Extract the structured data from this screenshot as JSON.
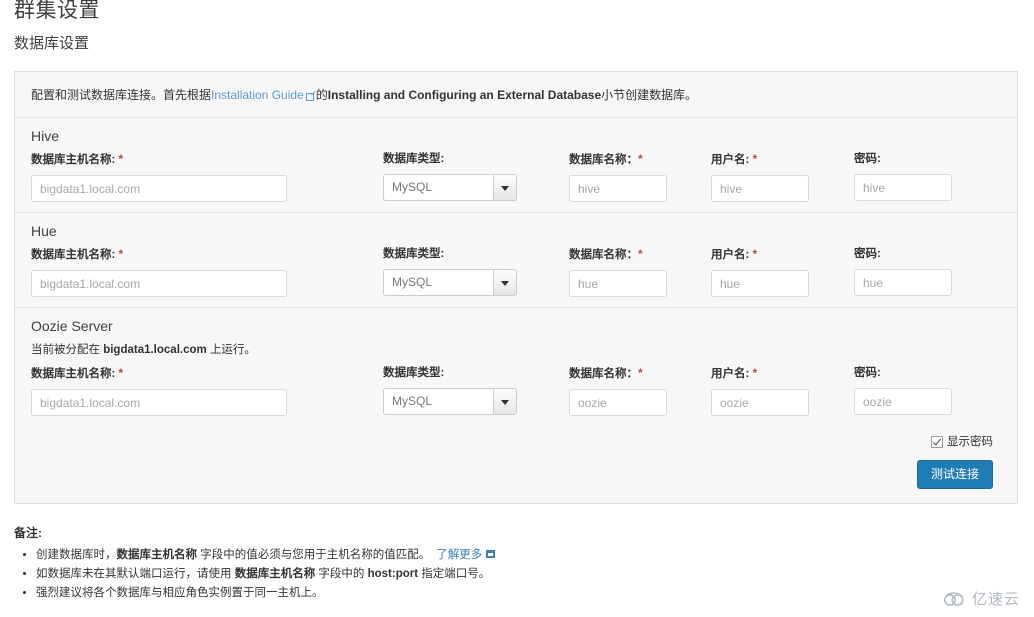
{
  "page": {
    "title": "群集设置",
    "subtitle": "数据库设置"
  },
  "panel": {
    "desc_before_link": "配置和测试数据库连接。首先根据",
    "desc_link": "Installation Guide",
    "desc_mid": "的",
    "desc_bold": "Installing and Configuring an External Database",
    "desc_after": "小节创建数据库。"
  },
  "labels": {
    "host": "数据库主机名称:",
    "type": "数据库类型:",
    "dbname": "数据库名称：",
    "username": "用户名:",
    "password": "密码:",
    "required_mark": "*"
  },
  "services": [
    {
      "name": "Hive",
      "note": "",
      "host_value": "bigdata1.local.com",
      "type_value": "MySQL",
      "db_value": "hive",
      "user_value": "hive",
      "pass_value": "hive"
    },
    {
      "name": "Hue",
      "note": "",
      "host_value": "bigdata1.local.com",
      "type_value": "MySQL",
      "db_value": "hue",
      "user_value": "hue",
      "pass_value": "hue"
    },
    {
      "name": "Oozie Server",
      "note_prefix": "当前被分配在 ",
      "note_bold": "bigdata1.local.com",
      "note_suffix": " 上运行。",
      "host_value": "bigdata1.local.com",
      "type_value": "MySQL",
      "db_value": "oozie",
      "user_value": "oozie",
      "pass_value": "oozie"
    }
  ],
  "footer": {
    "show_password_label": "显示密码",
    "show_password_checked": true,
    "test_button_label": "测试连接"
  },
  "notes": {
    "title": "备注:",
    "items": [
      {
        "pre": "创建数据库时，",
        "bold": "数据库主机名称",
        "post": " 字段中的值必须与您用于主机名称的值匹配。",
        "link": "了解更多"
      },
      {
        "pre": "如数据库未在其默认端口运行，请使用 ",
        "bold": "数据库主机名称",
        "post": " 字段中的 ",
        "bold2": "host:port",
        "post2": " 指定端口号。"
      },
      {
        "pre": "强烈建议将各个数据库与相应角色实例置于同一主机上。"
      }
    ]
  },
  "watermark": {
    "text": "亿速云"
  },
  "colors": {
    "accent": "#1f7cb4",
    "link": "#5b9bd5",
    "required": "#b94a48",
    "panel_bg": "#f7f7f7",
    "panel_border": "#dcdcdc"
  }
}
